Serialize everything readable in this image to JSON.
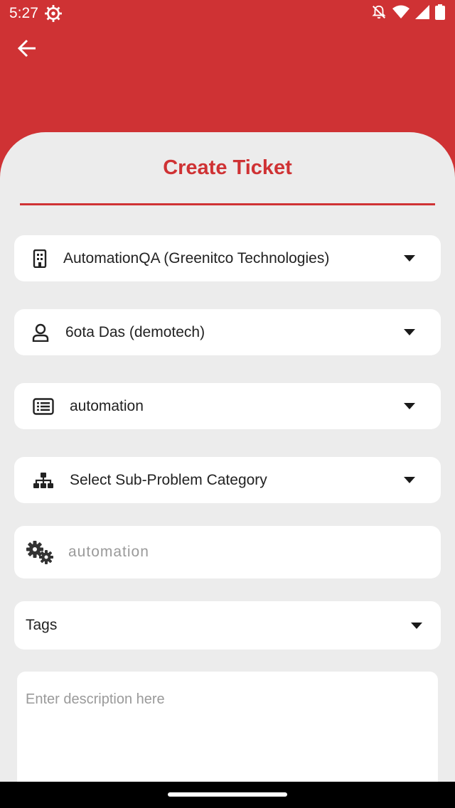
{
  "status": {
    "time": "5:27"
  },
  "header": {
    "back_icon": "arrow-left-icon"
  },
  "page": {
    "title": "Create Ticket"
  },
  "form": {
    "company": {
      "value": "AutomationQA (Greenitco Technologies)",
      "icon": "building-icon"
    },
    "user": {
      "value": "6ota Das (demotech)",
      "icon": "person-icon"
    },
    "problem_category": {
      "value": "automation",
      "icon": "list-icon"
    },
    "sub_problem_category": {
      "placeholder": "Select Sub-Problem Category",
      "icon": "hierarchy-icon"
    },
    "subject": {
      "value": "automation",
      "icon": "gears-icon"
    },
    "tags": {
      "label": "Tags"
    },
    "description": {
      "placeholder": "Enter description here"
    }
  },
  "colors": {
    "primary": "#cf3234",
    "background": "#ececec",
    "card": "#ffffff"
  }
}
